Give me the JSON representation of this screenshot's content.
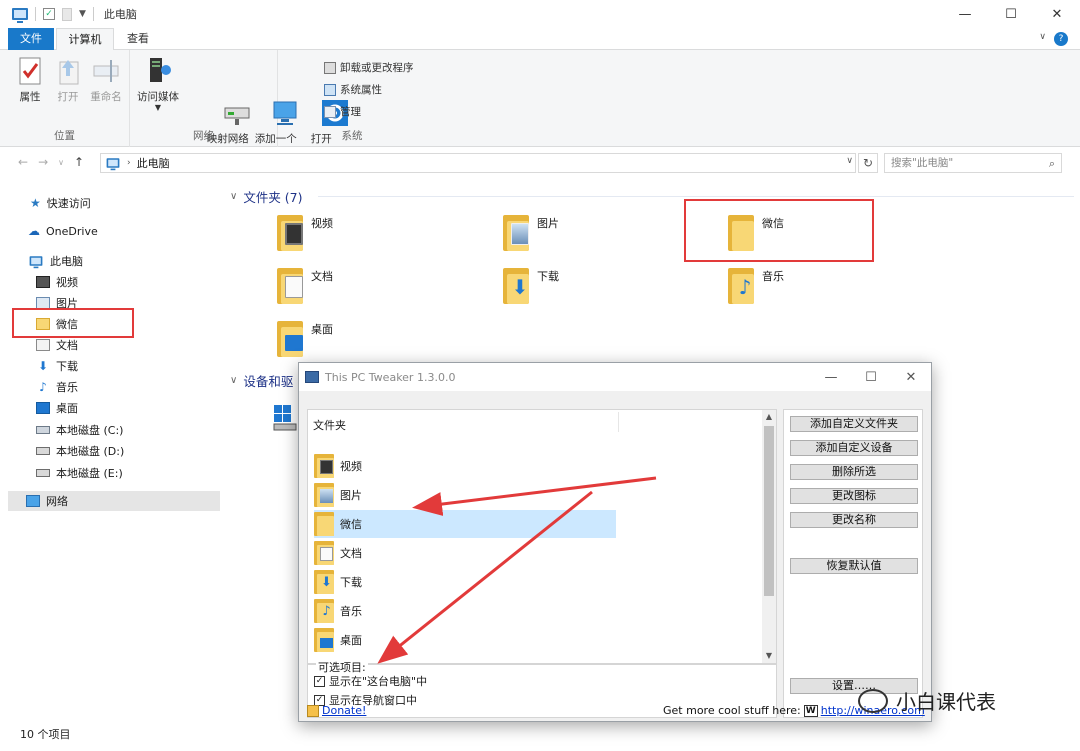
{
  "window": {
    "title": "此电脑",
    "controls": {
      "minimize": "—",
      "maximize": "☐",
      "close": "✕"
    }
  },
  "tabs": [
    {
      "label": "文件",
      "active": false
    },
    {
      "label": "计算机",
      "active": true
    },
    {
      "label": "查看",
      "active": false
    }
  ],
  "help": "?",
  "ribbon": {
    "groups": [
      {
        "label": "位置",
        "buttons": [
          "属性",
          "打开",
          "重命名"
        ]
      },
      {
        "label": "网络",
        "buttons": [
          "访问媒体",
          "映射网络\n驱动器",
          "添加一个\n网络位置"
        ]
      },
      {
        "label": "系统",
        "buttons": [
          "打开\n设置"
        ],
        "small": [
          "卸载或更改程序",
          "系统属性",
          "管理"
        ]
      }
    ]
  },
  "address": {
    "path": "此电脑",
    "search_placeholder": "搜索\"此电脑\""
  },
  "navpane": {
    "quick_access": "快速访问",
    "onedrive": "OneDrive",
    "this_pc": "此电脑",
    "children": [
      "视频",
      "图片",
      "微信",
      "文档",
      "下载",
      "音乐",
      "桌面",
      "本地磁盘 (C:)",
      "本地磁盘 (D:)",
      "本地磁盘 (E:)"
    ],
    "network": "网络"
  },
  "content": {
    "folders_header": "文件夹 (7)",
    "folders": [
      "视频",
      "图片",
      "微信",
      "文档",
      "下载",
      "音乐",
      "桌面"
    ],
    "devices_header": "设备和驱"
  },
  "status": {
    "items": "10 个项目"
  },
  "dialog": {
    "title": "This PC Tweaker 1.3.0.0",
    "list_header": "文件夹",
    "list_items": [
      "视频",
      "图片",
      "微信",
      "文档",
      "下载",
      "音乐",
      "桌面"
    ],
    "selected": "微信",
    "options_label": "可选项目:",
    "option1": "显示在\"这台电脑\"中",
    "option2": "显示在导航窗口中",
    "buttons": [
      "添加自定义文件夹",
      "添加自定义设备",
      "删除所选",
      "更改图标",
      "更改名称",
      "恢复默认值",
      "设置……"
    ],
    "donate": "Donate!",
    "get_more": "Get more cool stuff here:",
    "link": "http://winaero.com"
  },
  "watermark": "小白课代表",
  "colors": {
    "accent": "#1979ca",
    "highlight": "#e23a3a",
    "folder": "#f8d775",
    "selection": "#cce8ff"
  }
}
